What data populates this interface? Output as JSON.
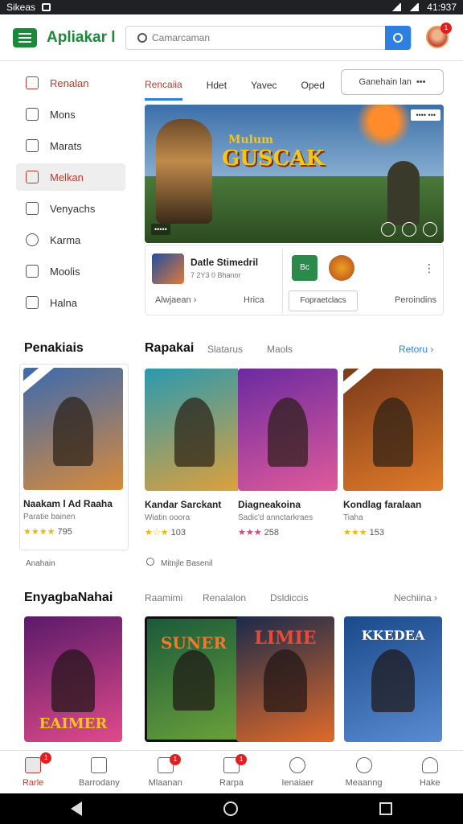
{
  "status": {
    "left": "Sikeas",
    "time": "41:937"
  },
  "app": {
    "title": "Apliakar l",
    "search_placeholder": "Camarcaman",
    "avatar_badge": "1"
  },
  "sidebar": {
    "items": [
      {
        "label": "Renalan",
        "icon": "gamepad-icon"
      },
      {
        "label": "Mons",
        "icon": "file-icon"
      },
      {
        "label": "Marats",
        "icon": "pen-icon"
      },
      {
        "label": "Melkan",
        "icon": "folder-icon"
      },
      {
        "label": "Venyachs",
        "icon": "map-icon"
      },
      {
        "label": "Karma",
        "icon": "clock-icon"
      },
      {
        "label": "Moolis",
        "icon": "user-icon"
      },
      {
        "label": "Halna",
        "icon": "grid-icon"
      }
    ]
  },
  "tabs": {
    "items": [
      "Rencaiia",
      "Hdet",
      "Yavec",
      "Oped"
    ],
    "select_label": "Ganehain lan",
    "select_more": "•••"
  },
  "hero": {
    "title": "GUSCAK",
    "title_top": "Mulum",
    "flag": "•••• •••",
    "caption": "•••••"
  },
  "info": {
    "name": "Datle Stimedril",
    "sub": "7 2Y3 0 Bhanor",
    "btn1": "Alwjaean ›",
    "lbl1": "Hrica",
    "icon_a": "Bc",
    "btn2": "Fopraetclacs",
    "lbl2": "Peroindins"
  },
  "section1": {
    "left_title": "Penakiais",
    "title": "Rapakai",
    "links": [
      "Slatarus",
      "Maols"
    ],
    "more": "Retoru ›",
    "cards": [
      {
        "title": "Naakam l Ad Raaha",
        "sub": "Paratie bainen",
        "stars": "★★★★",
        "rating": "795",
        "colors": [
          "#3b6ab0",
          "#d88a3a"
        ]
      },
      {
        "title": "Kandar Sarckant",
        "sub": "Wiatin ooora",
        "stars": "★☆★",
        "rating": "103",
        "colors": [
          "#2a9ab0",
          "#e0a03a"
        ]
      },
      {
        "title": "Diagneakoina",
        "sub": "Sadic'd annctarkraes",
        "stars": "★★★",
        "rating": "258",
        "colors": [
          "#6a2aa0",
          "#e05a9a"
        ]
      },
      {
        "title": "Kondlag faralaan",
        "sub": "Tiaha",
        "stars": "★★★",
        "rating": "153",
        "colors": [
          "#7a3a1a",
          "#e07a2a"
        ]
      }
    ],
    "meta_left": "Anahain",
    "meta_mid": "Mitnjle Basenil"
  },
  "section2": {
    "title": "EnyagbaNahai",
    "links": [
      "Raamimi",
      "Renalalon",
      "Dsldiccis"
    ],
    "more": "Nechiina ›",
    "cards": [
      {
        "caption": "EAIMER",
        "colors": [
          "#5a1a6a",
          "#e04a8a"
        ]
      },
      {
        "caption": "SUNER",
        "colors": [
          "#1a5a3a",
          "#6aa03a"
        ]
      },
      {
        "caption": "LIMIE",
        "colors": [
          "#1a2a4a",
          "#e06a2a"
        ]
      },
      {
        "caption": "KKEDEA",
        "colors": [
          "#1a4a8a",
          "#5a8ad0"
        ]
      }
    ]
  },
  "bottomnav": {
    "items": [
      {
        "label": "Rarle",
        "icon": "home-icon",
        "badge": "1"
      },
      {
        "label": "Barrodany",
        "icon": "mail-icon",
        "badge": ""
      },
      {
        "label": "Mlaanan",
        "icon": "inbox-icon",
        "badge": "1"
      },
      {
        "label": "Rarpa",
        "icon": "box-icon",
        "badge": "1"
      },
      {
        "label": "Ienaiaer",
        "icon": "chat-icon",
        "badge": ""
      },
      {
        "label": "Meaanng",
        "icon": "search-icon",
        "badge": ""
      },
      {
        "label": "Hake",
        "icon": "person-icon",
        "badge": ""
      }
    ]
  }
}
